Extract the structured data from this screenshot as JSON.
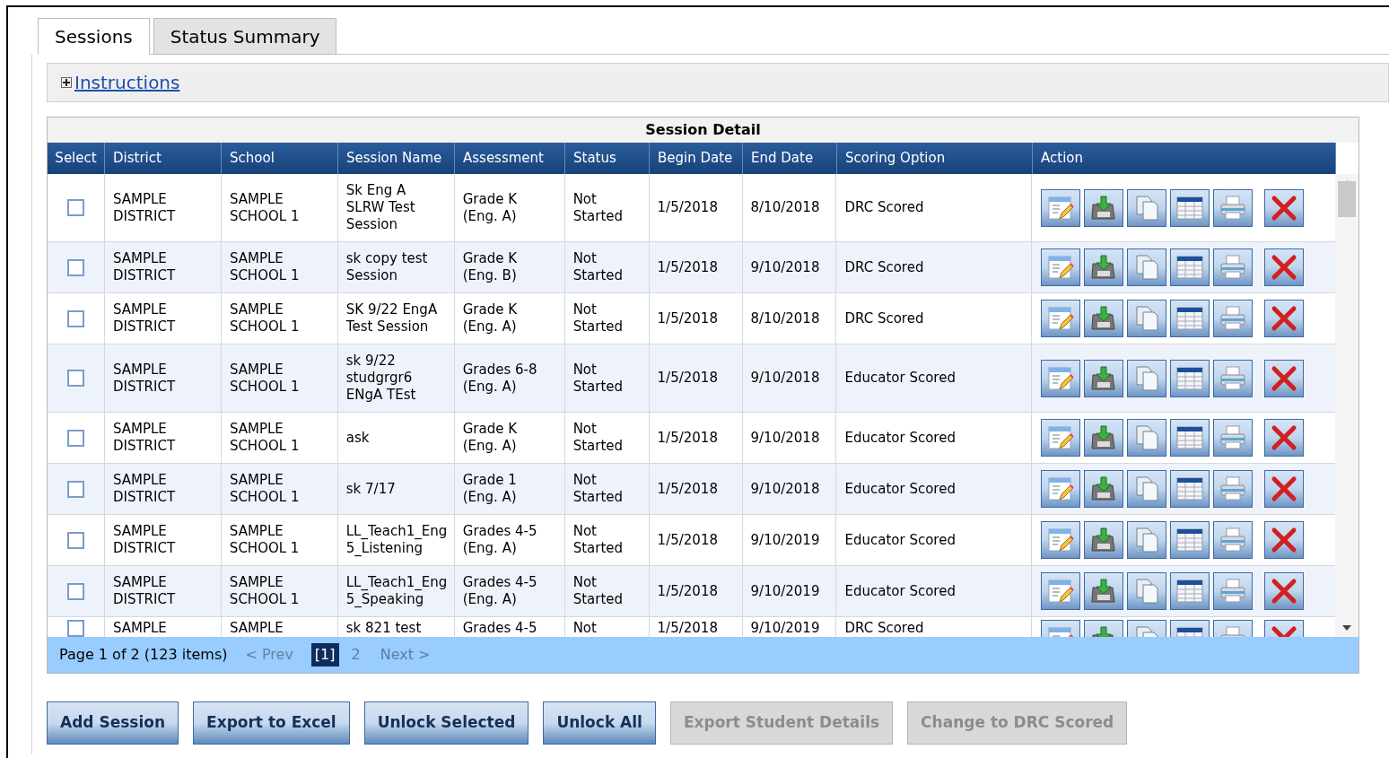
{
  "tabs": [
    {
      "label": "Sessions",
      "selected": true
    },
    {
      "label": "Status Summary",
      "selected": false
    }
  ],
  "instructions": {
    "label": "Instructions",
    "expanded": false
  },
  "table": {
    "title": "Session Detail",
    "columns": [
      "Select",
      "District",
      "School",
      "Session Name",
      "Assessment",
      "Status",
      "Begin Date",
      "End Date",
      "Scoring Option",
      "Action"
    ],
    "rows": [
      {
        "selected": false,
        "district": "SAMPLE\nDISTRICT",
        "school": "SAMPLE\nSCHOOL 1",
        "session_name": "Sk Eng A\nSLRW Test\nSession",
        "assessment": "Grade K\n(Eng. A)",
        "status": "Not\nStarted",
        "begin_date": "1/5/2018",
        "end_date": "8/10/2018",
        "scoring_option": "DRC Scored"
      },
      {
        "selected": false,
        "district": "SAMPLE\nDISTRICT",
        "school": "SAMPLE\nSCHOOL 1",
        "session_name": "sk copy test\nSession",
        "assessment": "Grade K\n(Eng. B)",
        "status": "Not\nStarted",
        "begin_date": "1/5/2018",
        "end_date": "9/10/2018",
        "scoring_option": "DRC Scored"
      },
      {
        "selected": false,
        "district": "SAMPLE\nDISTRICT",
        "school": "SAMPLE\nSCHOOL 1",
        "session_name": "SK 9/22 EngA\nTest Session",
        "assessment": "Grade K\n(Eng. A)",
        "status": "Not\nStarted",
        "begin_date": "1/5/2018",
        "end_date": "8/10/2018",
        "scoring_option": "DRC Scored"
      },
      {
        "selected": false,
        "district": "SAMPLE\nDISTRICT",
        "school": "SAMPLE\nSCHOOL 1",
        "session_name": "sk 9/22\nstudgrgr6\nENgA TEst",
        "assessment": "Grades 6-8\n(Eng. A)",
        "status": "Not\nStarted",
        "begin_date": "1/5/2018",
        "end_date": "9/10/2018",
        "scoring_option": "Educator Scored"
      },
      {
        "selected": false,
        "district": "SAMPLE\nDISTRICT",
        "school": "SAMPLE\nSCHOOL 1",
        "session_name": "ask",
        "assessment": "Grade K\n(Eng. A)",
        "status": "Not\nStarted",
        "begin_date": "1/5/2018",
        "end_date": "9/10/2018",
        "scoring_option": "Educator Scored"
      },
      {
        "selected": false,
        "district": "SAMPLE\nDISTRICT",
        "school": "SAMPLE\nSCHOOL 1",
        "session_name": "sk 7/17",
        "assessment": "Grade 1\n(Eng. A)",
        "status": "Not\nStarted",
        "begin_date": "1/5/2018",
        "end_date": "9/10/2018",
        "scoring_option": "Educator Scored"
      },
      {
        "selected": false,
        "district": "SAMPLE\nDISTRICT",
        "school": "SAMPLE\nSCHOOL 1",
        "session_name": "LL_Teach1_Eng\n5_Listening",
        "assessment": "Grades 4-5\n(Eng. A)",
        "status": "Not\nStarted",
        "begin_date": "1/5/2018",
        "end_date": "9/10/2019",
        "scoring_option": "Educator Scored"
      },
      {
        "selected": false,
        "district": "SAMPLE\nDISTRICT",
        "school": "SAMPLE\nSCHOOL 1",
        "session_name": "LL_Teach1_Eng\n5_Speaking",
        "assessment": "Grades 4-5\n(Eng. A)",
        "status": "Not\nStarted",
        "begin_date": "1/5/2018",
        "end_date": "9/10/2019",
        "scoring_option": "Educator Scored"
      },
      {
        "selected": false,
        "district": "SAMPLE",
        "school": "SAMPLE",
        "session_name": "sk 821 test",
        "assessment": "Grades 4-5",
        "status": "Not",
        "begin_date": "1/5/2018",
        "end_date": "9/10/2019",
        "scoring_option": "DRC Scored"
      }
    ]
  },
  "pager": {
    "summary": "Page 1 of 2 (123 items)",
    "prev": "< Prev",
    "pages": [
      {
        "label": "[1]",
        "selected": true
      },
      {
        "label": "2",
        "selected": false
      }
    ],
    "next": "Next >"
  },
  "buttons": [
    {
      "label": "Add Session",
      "disabled": false
    },
    {
      "label": "Export to Excel",
      "disabled": false
    },
    {
      "label": "Unlock Selected",
      "disabled": false
    },
    {
      "label": "Unlock All",
      "disabled": false
    },
    {
      "label": "Export Student Details",
      "disabled": true
    },
    {
      "label": "Change to DRC Scored",
      "disabled": true
    }
  ]
}
